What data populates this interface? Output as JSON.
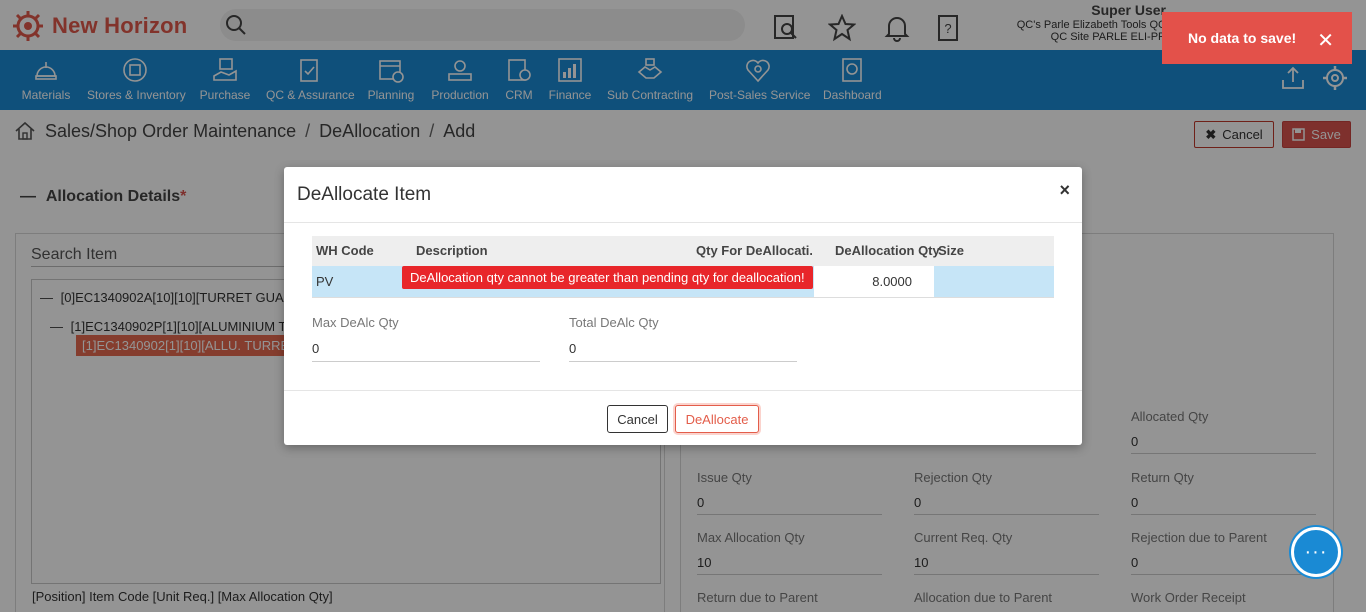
{
  "app": {
    "name": "New Horizon"
  },
  "header": {
    "user_name": "Super User",
    "company": "QC's Parle Elizabeth Tools QC",
    "site": "QC Site PARLE ELI-PR"
  },
  "toast": {
    "message": "No data to save!"
  },
  "nav": [
    {
      "label": "Materials",
      "icon": "materials-icon"
    },
    {
      "label": "Stores & Inventory",
      "icon": "stores-icon"
    },
    {
      "label": "Purchase",
      "icon": "purchase-icon"
    },
    {
      "label": "QC & Assurance",
      "icon": "qc-icon"
    },
    {
      "label": "Planning",
      "icon": "planning-icon"
    },
    {
      "label": "Production",
      "icon": "production-icon"
    },
    {
      "label": "CRM",
      "icon": "crm-icon"
    },
    {
      "label": "Finance",
      "icon": "finance-icon"
    },
    {
      "label": "Sub Contracting",
      "icon": "subcontracting-icon"
    },
    {
      "label": "Post-Sales Service",
      "icon": "post-sales-icon"
    },
    {
      "label": "Dashboard",
      "icon": "dashboard-icon"
    }
  ],
  "breadcrumb": [
    "Sales/Shop Order Maintenance",
    "DeAllocation",
    "Add"
  ],
  "toolbar": {
    "cancel_label": "Cancel",
    "save_label": "Save"
  },
  "allocation": {
    "title": "Allocation Details",
    "required_mark": "*",
    "search_label": "Search Item",
    "tree": [
      "[0]EC1340902A[10][10][TURRET GUARD",
      "[1]EC1340902P[1][10][ALUMINIUM TU",
      "[1]EC1340902[1][10][ALLU. TURRET"
    ],
    "tree_footer": "[Position] Item Code [Unit Req.] [Max Allocation Qty]"
  },
  "details": [
    {
      "label": "Allocated Qty",
      "value": "0"
    },
    {
      "label": "Issue Qty",
      "value": "0"
    },
    {
      "label": "Rejection Qty",
      "value": "0"
    },
    {
      "label": "Return Qty",
      "value": "0"
    },
    {
      "label": "Max Allocation Qty",
      "value": "10"
    },
    {
      "label": "Current Req. Qty",
      "value": "10"
    },
    {
      "label": "Rejection due to Parent",
      "value": "0"
    },
    {
      "label": "Return due to Parent",
      "value": ""
    },
    {
      "label": "Allocation due to Parent",
      "value": ""
    },
    {
      "label": "Work Order Receipt",
      "value": ""
    }
  ],
  "modal": {
    "title": "DeAllocate Item",
    "close": "×",
    "columns": [
      "WH Code",
      "Description",
      "Qty For DeAllocati...",
      "DeAllocation Qty",
      "Size"
    ],
    "row": {
      "wh_code": "PV",
      "description": "",
      "qty_for_dealloc": "",
      "dealloc_qty": "8.0000",
      "size": ""
    },
    "error": "DeAllocation qty cannot be greater than pending qty for deallocation!",
    "max_label": "Max DeAlc Qty",
    "max_value": "0",
    "total_label": "Total DeAlc Qty",
    "total_value": "0",
    "cancel_label": "Cancel",
    "dealloc_label": "DeAllocate"
  },
  "chat": {
    "glyph": "···"
  }
}
